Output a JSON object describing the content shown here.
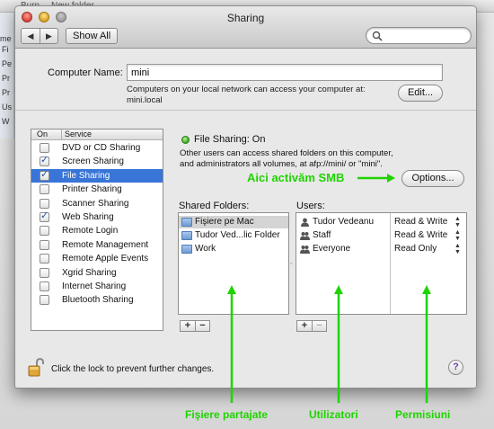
{
  "backdrop": {
    "top_labels": [
      "Burn",
      "New folder"
    ],
    "sidebar_items": [
      "Fi",
      "Pe",
      "Pr",
      "Pr",
      "Us",
      "W",
      "me"
    ]
  },
  "window": {
    "title": "Sharing",
    "toolbar": {
      "back_icon": "back-arrow-icon",
      "forward_icon": "forward-arrow-icon",
      "show_all_label": "Show All",
      "search_placeholder": ""
    }
  },
  "computer_name": {
    "label": "Computer Name:",
    "value": "mini",
    "description_line1": "Computers on your local network can access your computer at:",
    "description_line2": "mini.local",
    "edit_label": "Edit..."
  },
  "services": {
    "header_on": "On",
    "header_service": "Service",
    "items": [
      {
        "name": "DVD or CD Sharing",
        "checked": false,
        "selected": false
      },
      {
        "name": "Screen Sharing",
        "checked": true,
        "selected": false
      },
      {
        "name": "File Sharing",
        "checked": true,
        "selected": true
      },
      {
        "name": "Printer Sharing",
        "checked": false,
        "selected": false
      },
      {
        "name": "Scanner Sharing",
        "checked": false,
        "selected": false
      },
      {
        "name": "Web Sharing",
        "checked": true,
        "selected": false
      },
      {
        "name": "Remote Login",
        "checked": false,
        "selected": false
      },
      {
        "name": "Remote Management",
        "checked": false,
        "selected": false
      },
      {
        "name": "Remote Apple Events",
        "checked": false,
        "selected": false
      },
      {
        "name": "Xgrid Sharing",
        "checked": false,
        "selected": false
      },
      {
        "name": "Internet Sharing",
        "checked": false,
        "selected": false
      },
      {
        "name": "Bluetooth Sharing",
        "checked": false,
        "selected": false
      }
    ]
  },
  "file_sharing": {
    "status": "File Sharing: On",
    "status_color": "#38a61c",
    "description_line1": "Other users can access shared folders on this computer,",
    "description_line2": "and administrators all volumes, at afp://mini/ or \"mini\".",
    "options_label": "Options...",
    "shared_folders_label": "Shared Folders:",
    "users_label": "Users:",
    "folders": [
      {
        "name": "Fişiere pe Mac",
        "selected": true
      },
      {
        "name": "Tudor Ved...lic Folder",
        "selected": false
      },
      {
        "name": "Work",
        "selected": false
      }
    ],
    "users": [
      {
        "name": "Tudor Vedeanu",
        "icon": "user-icon",
        "permission": "Read & Write"
      },
      {
        "name": "Staff",
        "icon": "group-icon",
        "permission": "Read & Write"
      },
      {
        "name": "Everyone",
        "icon": "group-icon",
        "permission": "Read Only"
      }
    ],
    "add_label": "+",
    "remove_label": "−"
  },
  "footer": {
    "lock_text": "Click the lock to prevent further changes.",
    "help_label": "?"
  },
  "annotations": {
    "color": "#1fd400",
    "smb": "Aici activăm SMB",
    "shared_folders": "Fişiere partajate",
    "users": "Utilizatori",
    "permissions": "Permisiuni"
  }
}
